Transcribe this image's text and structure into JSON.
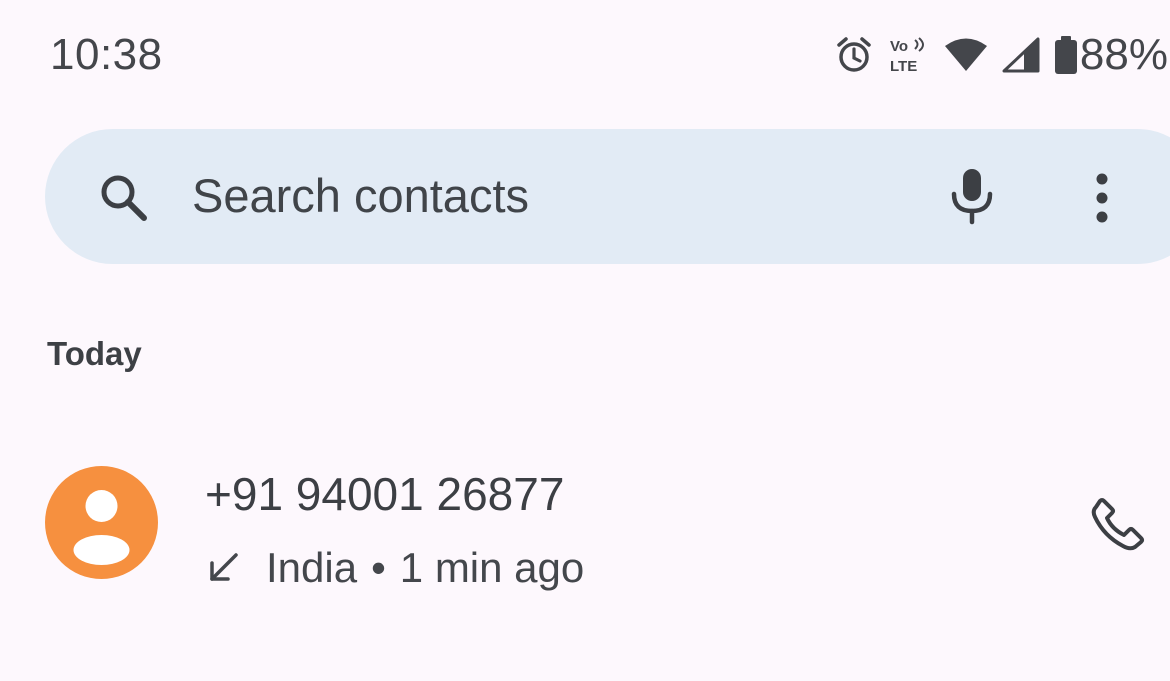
{
  "status_bar": {
    "time": "10:38",
    "battery_percent": "88%",
    "icons": [
      "alarm-icon",
      "volte-icon",
      "wifi-icon",
      "cellular-signal-icon",
      "battery-icon"
    ],
    "volte_top": "Vo",
    "volte_bottom": "LTE"
  },
  "search": {
    "placeholder": "Search contacts",
    "icons": [
      "search-icon",
      "microphone-icon",
      "more-vert-icon"
    ]
  },
  "section_header": "Today",
  "call_log": [
    {
      "number": "+91 94001 26877",
      "location": "India",
      "separator": "•",
      "time_ago": "1 min ago",
      "call_type_icon": "incoming-call-arrow-icon",
      "avatar_color": "#f6903f",
      "action_icon": "phone-icon"
    }
  ],
  "colors": {
    "background": "#fdf8fd",
    "search_bar": "#e2ebf5",
    "text_primary": "#3c3f44",
    "avatar": "#f6903f"
  }
}
